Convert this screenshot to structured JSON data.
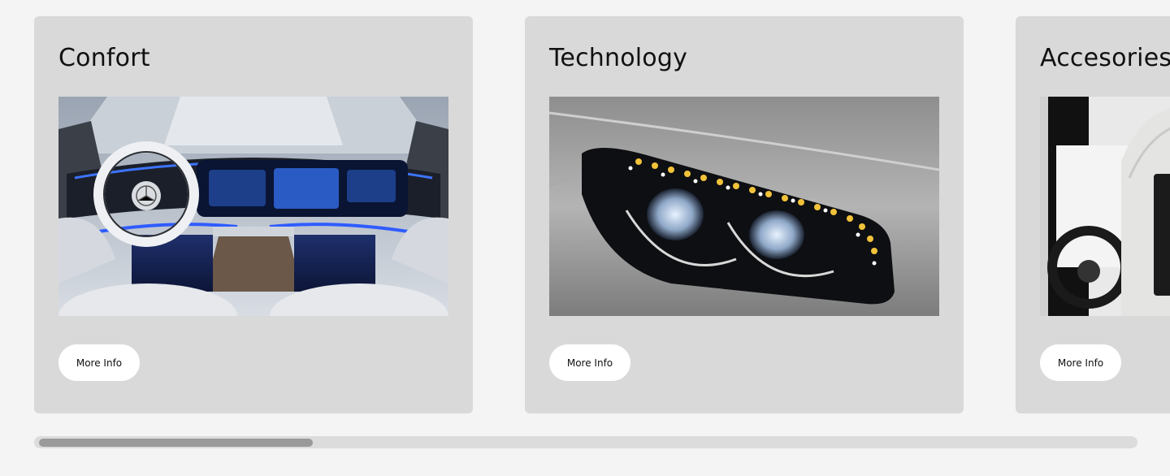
{
  "cards": [
    {
      "title": "Confort",
      "image": "car-interior-dashboard",
      "button_label": "More Info"
    },
    {
      "title": "Technology",
      "image": "led-headlight",
      "button_label": "More Info"
    },
    {
      "title": "Accesories",
      "image": "rear-seat-entertainment",
      "button_label": "More Info"
    }
  ],
  "scrollbar": {
    "position": 0,
    "visible_fraction": 0.25
  },
  "colors": {
    "page_background": "#f4f4f4",
    "card_background": "#d9d9d9",
    "button_background": "#ffffff",
    "scroll_track": "#dcdcdc",
    "scroll_thumb": "#9a9a9a"
  }
}
